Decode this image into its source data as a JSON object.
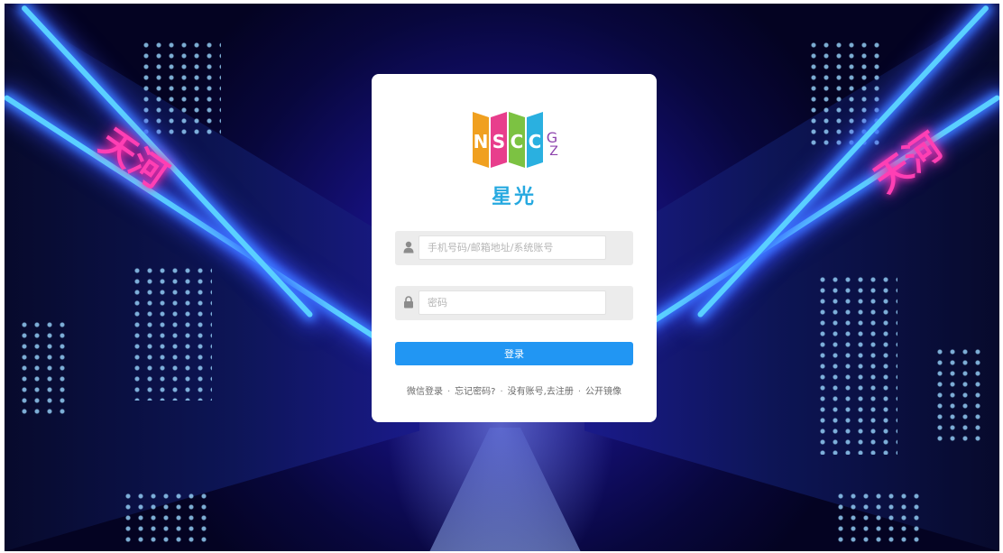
{
  "background": {
    "neon_left": "天河",
    "neon_right": "天河"
  },
  "logo": {
    "letters": [
      "N",
      "S",
      "C",
      "C",
      "GZ"
    ],
    "colors": [
      "#f0a020",
      "#e83e8c",
      "#7cc242",
      "#2ab0e0",
      "#8e44ad"
    ]
  },
  "brand": {
    "name": "星光",
    "color": "#26a9e0"
  },
  "form": {
    "username_placeholder": "手机号码/邮箱地址/系统账号",
    "username_value": "",
    "password_placeholder": "密码",
    "password_value": "",
    "login_label": "登录",
    "login_color": "#2196f3"
  },
  "links": {
    "wechat": "微信登录",
    "forgot": "忘记密码?",
    "register": "没有账号,去注册",
    "mirror": "公开镜像",
    "separator": "·"
  },
  "icons": {
    "username": "user-icon",
    "password": "lock-icon"
  }
}
